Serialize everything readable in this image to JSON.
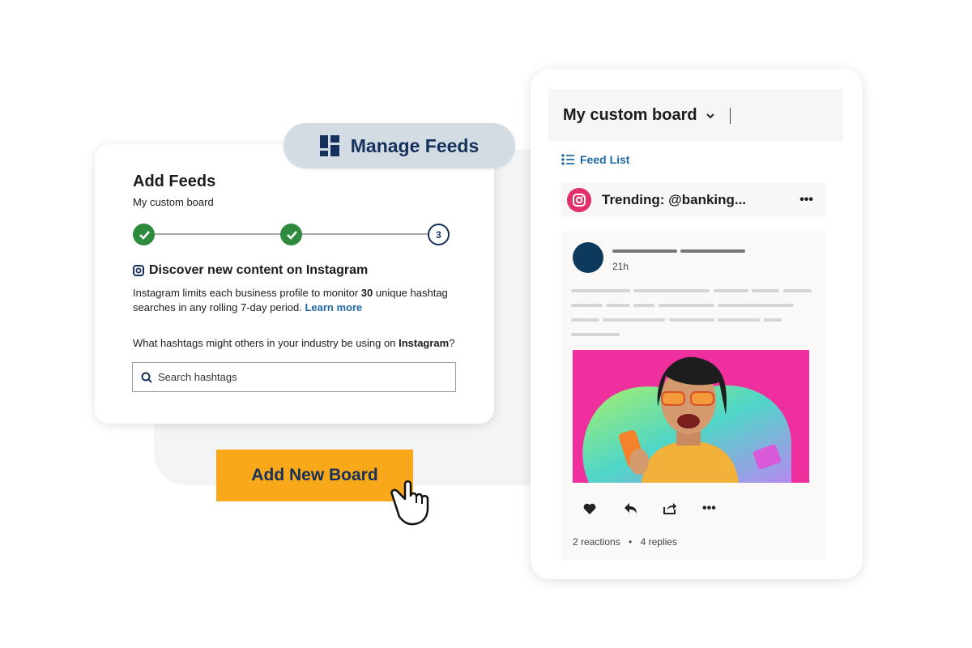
{
  "manage_feeds": {
    "label": "Manage Feeds",
    "icon": "dashboard-icon"
  },
  "add_feeds": {
    "title": "Add Feeds",
    "board_name": "My custom board",
    "steps": [
      {
        "state": "done"
      },
      {
        "state": "done"
      },
      {
        "state": "current",
        "label": "3"
      }
    ],
    "section_title": "Discover new content on Instagram",
    "desc_before": "Instagram limits each business profile to monitor ",
    "desc_bold": "30",
    "desc_after": " unique hashtag searches in any rolling 7-day period. ",
    "learn_more": "Learn more",
    "question_before": "What hashtags might others in your industry be using on ",
    "question_bold": "Instagram",
    "question_after": "?",
    "search_placeholder": "Search hashtags"
  },
  "add_board_button": "Add New Board",
  "board": {
    "title": "My custom board",
    "feed_list": "Feed List",
    "feed_title": "Trending: @banking...",
    "post": {
      "time": "21h",
      "reactions": "2 reactions",
      "separator": "•",
      "replies": "4 replies"
    }
  },
  "colors": {
    "accent": "#f9a81a",
    "navy": "#15305a",
    "link": "#1f6aa5",
    "success": "#2e8b3e",
    "instagram": "#e1306c"
  }
}
